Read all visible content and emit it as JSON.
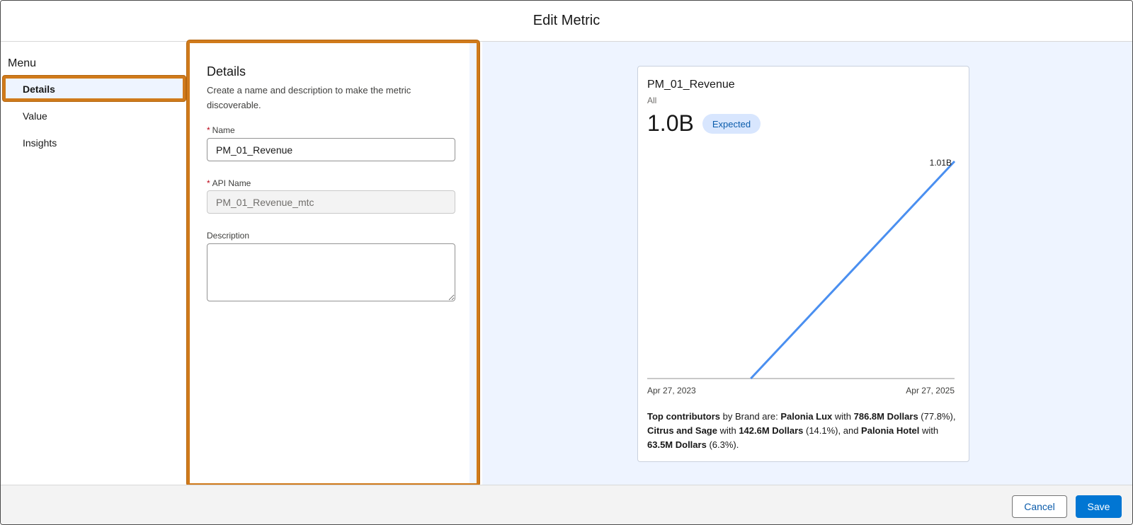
{
  "header": {
    "title": "Edit Metric"
  },
  "menu": {
    "title": "Menu",
    "items": [
      {
        "label": "Details",
        "active": true
      },
      {
        "label": "Value",
        "active": false
      },
      {
        "label": "Insights",
        "active": false
      }
    ]
  },
  "details": {
    "title": "Details",
    "description": "Create a name and description to make the metric discoverable.",
    "name_label": "Name",
    "name_value": "PM_01_Revenue",
    "api_label": "API Name",
    "api_value": "PM_01_Revenue_mtc",
    "description_label": "Description",
    "description_value": "",
    "required_mark": "*"
  },
  "preview": {
    "title": "PM_01_Revenue",
    "subtitle": "All",
    "value": "1.0B",
    "badge": "Expected",
    "contributors": {
      "lead": "Top contributors",
      "by": " by Brand are: ",
      "items": [
        {
          "name": "Palonia Lux",
          "value": "786.8M Dollars",
          "pct": "(77.8%)"
        },
        {
          "name": "Citrus and Sage",
          "value": "142.6M Dollars",
          "pct": "(14.1%)"
        },
        {
          "name": "Palonia Hotel",
          "value": "63.5M Dollars",
          "pct": "(6.3%)"
        }
      ]
    }
  },
  "chart_data": {
    "type": "line",
    "x": [
      "Apr 27, 2023",
      "Apr 27, 2025"
    ],
    "series": [
      {
        "values": [
          null,
          1.01
        ]
      }
    ],
    "end_label": "1.01B",
    "x_tick_labels": [
      "Apr 27, 2023",
      "Apr 27, 2025"
    ],
    "line_color": "#4a8ff0",
    "grid": false
  },
  "footer": {
    "cancel_label": "Cancel",
    "save_label": "Save"
  },
  "colors": {
    "accent": "#0176d3",
    "highlight": "#d07a1b",
    "badge_bg": "#d8e6fe"
  }
}
